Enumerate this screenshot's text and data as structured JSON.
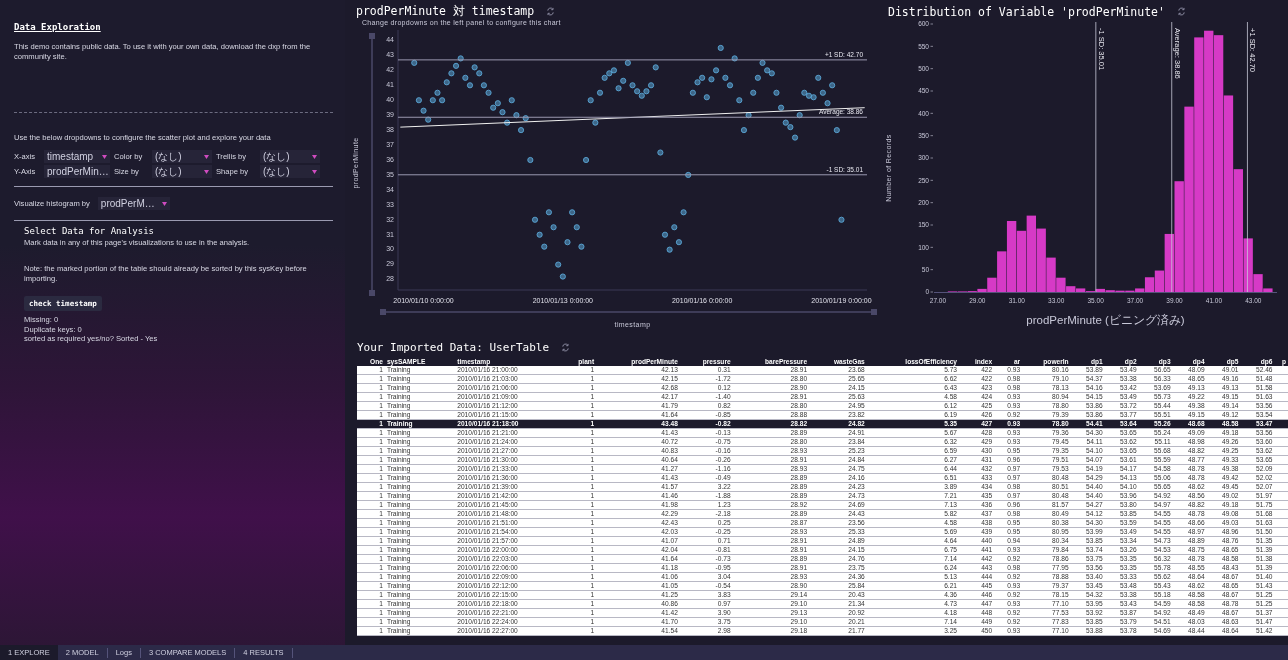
{
  "left_panel": {
    "heading": "Data Exploration",
    "intro": "This demo contains public data. To use it with your own data, download the dxp from the community site.",
    "instructions": "Use the below dropdowns to configure the scatter plot and explore your data",
    "dropdowns": [
      {
        "label": "X-axis",
        "value": "timestamp"
      },
      {
        "label": "Color by",
        "value": "(なし)"
      },
      {
        "label": "Trellis by",
        "value": "(なし)"
      },
      {
        "label": "Y-Axis",
        "value": "prodPerMin…"
      },
      {
        "label": "Size by",
        "value": "(なし)"
      },
      {
        "label": "Shape by",
        "value": "(なし)"
      }
    ],
    "histogram_dropdown": {
      "label": "Visualize histogram by",
      "value": "prodPerM…"
    },
    "select_title": "Select Data for Analysis",
    "select_text": "Mark data in any of this page's visualizations to use in the analysis.",
    "note": "Note: the marked portion of the table should already be sorted by this sysKey before importing.",
    "button": "check timestamp",
    "results": [
      "Missing:  0",
      "Duplicate keys: 0",
      "sorted as required yes/no? Sorted - Yes"
    ]
  },
  "scatter": {
    "subtitle": "Change dropdowns on the left panel to configure this chart",
    "chart_data": {
      "type": "scatter",
      "title": "prodPerMinute 対 timestamp",
      "xlabel": "timestamp",
      "ylabel": "prodPerMinute",
      "categories": [
        null,
        null,
        null,
        null,
        null,
        "2010/01/10 0:00:00",
        null,
        null,
        null,
        null,
        null,
        null,
        null,
        null,
        null,
        null,
        null,
        null,
        null,
        null,
        null,
        null,
        null,
        null,
        null,
        null,
        null,
        null,
        null,
        null,
        null,
        null,
        null,
        null,
        null,
        "2010/01/13 0:00:00",
        null,
        null,
        null,
        null,
        null,
        null,
        null,
        null,
        null,
        null,
        null,
        null,
        null,
        null,
        null,
        null,
        null,
        null,
        null,
        null,
        null,
        null,
        null,
        null,
        null,
        null,
        null,
        null,
        null,
        "2010/01/16 0:00:00",
        null,
        null,
        null,
        null,
        null,
        null,
        null,
        null,
        null,
        null,
        null,
        null,
        null,
        null,
        null,
        null,
        null,
        null,
        null,
        null,
        null,
        null,
        null,
        null,
        null,
        null,
        null,
        null,
        null,
        "2010/01/19 0:00:00",
        null,
        null,
        null,
        null,
        null
      ],
      "series": [
        {
          "color": "#5aa6d6",
          "values": [
            null,
            null,
            null,
            42.5,
            40,
            39.3,
            38.7,
            40,
            40.5,
            40,
            41.2,
            41.8,
            42.3,
            42.8,
            41.5,
            41,
            42.2,
            41.8,
            41,
            40.5,
            39.5,
            39.8,
            39.2,
            38.5,
            40,
            39,
            38,
            38.8,
            36,
            32,
            31,
            30.2,
            32.5,
            31.5,
            29,
            28.2,
            30.5,
            32.5,
            31.5,
            30.2,
            36,
            40,
            38.5,
            40.5,
            41.5,
            41.8,
            42,
            40.8,
            41.3,
            42.5,
            41,
            40.6,
            40.3,
            40.6,
            41,
            42.2,
            36.5,
            31,
            30,
            31.5,
            30.5,
            32.5,
            35,
            40.5,
            41.2,
            41.5,
            40.2,
            41.4,
            42,
            43.5,
            41.5,
            41,
            42.8,
            40,
            38,
            39,
            40.5,
            41.5,
            42.5,
            42,
            41.8,
            40.5,
            39.5,
            38.5,
            38.2,
            37.5,
            39,
            40.5,
            40.3,
            40.2,
            41.5,
            40.5,
            39.8,
            41,
            38,
            32,
            null,
            null,
            null,
            null,
            null
          ]
        },
        {
          "type": "line",
          "color": "#f0f0f0",
          "values": [
            38.2,
            null,
            null,
            null,
            null,
            null,
            null,
            null,
            null,
            null,
            null,
            null,
            null,
            null,
            null,
            null,
            null,
            null,
            null,
            null,
            null,
            null,
            null,
            null,
            null,
            null,
            null,
            null,
            null,
            null,
            null,
            null,
            null,
            null,
            null,
            null,
            null,
            null,
            null,
            null,
            null,
            null,
            null,
            null,
            null,
            null,
            null,
            null,
            null,
            null,
            null,
            null,
            null,
            null,
            null,
            null,
            null,
            null,
            null,
            null,
            null,
            null,
            null,
            null,
            null,
            null,
            null,
            null,
            null,
            null,
            null,
            null,
            null,
            null,
            null,
            null,
            null,
            null,
            null,
            null,
            null,
            null,
            null,
            null,
            null,
            null,
            null,
            null,
            null,
            null,
            null,
            null,
            null,
            null,
            null,
            null,
            null,
            null,
            null,
            null,
            39.5
          ]
        }
      ],
      "ylim": [
        27.3,
        44.7
      ],
      "yticks": [
        28,
        29,
        30,
        31,
        32,
        33,
        34,
        35,
        36,
        37,
        38,
        39,
        40,
        41,
        42,
        43,
        44
      ],
      "ref_lines": [
        {
          "axis": "y",
          "value": 42.7,
          "label": "+1 SD: 42.70"
        },
        {
          "axis": "y",
          "value": 38.86,
          "label": "Average: 38.86"
        },
        {
          "axis": "y",
          "value": 35.01,
          "label": "-1 SD: 35.01"
        }
      ]
    }
  },
  "histogram": {
    "chart_data": {
      "type": "bar",
      "title": "Distribution of Variable 'prodPerMinute'",
      "xlabel": "prodPerMinute (ビニング済み)",
      "ylabel": "Number of Records",
      "x": [
        27.75,
        28.25,
        28.75,
        29.25,
        29.75,
        30.25,
        30.75,
        31.25,
        31.75,
        32.25,
        32.75,
        33.25,
        33.75,
        34.25,
        34.75,
        35.25,
        35.75,
        36.25,
        36.75,
        37.25,
        37.75,
        38.25,
        38.75,
        39.25,
        39.75,
        40.25,
        40.75,
        41.25,
        41.75,
        42.25,
        42.75,
        43.25,
        43.75
      ],
      "values": [
        1,
        1,
        2,
        7,
        32,
        91,
        159,
        137,
        171,
        142,
        77,
        32,
        13,
        8,
        2,
        7,
        4,
        3,
        3,
        8,
        33,
        48,
        130,
        248,
        415,
        570,
        585,
        575,
        440,
        275,
        120,
        40,
        8
      ],
      "color": "#d63ac6",
      "xlim": [
        26.8,
        44.2
      ],
      "ylim": [
        0,
        600
      ],
      "xticks": [
        {
          "value": 27,
          "label": "27.00"
        },
        {
          "value": 29,
          "label": "29.00"
        },
        {
          "value": 31,
          "label": "31.00"
        },
        {
          "value": 33,
          "label": "33.00"
        },
        {
          "value": 35,
          "label": "35.00"
        },
        {
          "value": 37,
          "label": "37.00"
        },
        {
          "value": 39,
          "label": "39.00"
        },
        {
          "value": 41,
          "label": "41.00"
        },
        {
          "value": 43,
          "label": "43.00"
        }
      ],
      "yticks": [
        0,
        50,
        100,
        150,
        200,
        250,
        300,
        350,
        400,
        450,
        500,
        550,
        600
      ],
      "ref_lines": [
        {
          "axis": "x",
          "value": 35.01,
          "label": "-1 SD: 35.01"
        },
        {
          "axis": "x",
          "value": 38.86,
          "label": "Average: 38.86"
        },
        {
          "axis": "x",
          "value": 42.7,
          "label": "+1 SD: 42.70"
        }
      ]
    }
  },
  "table": {
    "title": "Your Imported Data: UserTable",
    "columns": [
      "One",
      "sysSAMPLE",
      "timestamp",
      "plant",
      "prodPerMinute",
      "pressure",
      "barePressure",
      "wasteGas",
      "lossOfEfficiency",
      "index",
      "ar",
      "powerIn",
      "dp1",
      "dp2",
      "dp3",
      "dp4",
      "dp5",
      "dp6",
      "p"
    ],
    "rows": [
      {
        "selected": false,
        "cells": [
          "1",
          "Training",
          "2010/01/16 21:00:00",
          "1",
          "42.13",
          "0.31",
          "28.91",
          "23.68",
          "5.73",
          "422",
          "0.93",
          "80.16",
          "53.89",
          "53.49",
          "56.65",
          "48.09",
          "49.01",
          "52.46"
        ]
      },
      {
        "selected": false,
        "cells": [
          "1",
          "Training",
          "2010/01/16 21:03:00",
          "1",
          "42.15",
          "-1.72",
          "28.80",
          "25.65",
          "6.62",
          "422",
          "0.98",
          "79.10",
          "54.37",
          "53.38",
          "56.33",
          "48.65",
          "49.16",
          "51.48"
        ]
      },
      {
        "selected": false,
        "cells": [
          "1",
          "Training",
          "2010/01/16 21:06:00",
          "1",
          "42.68",
          "0.12",
          "28.90",
          "24.15",
          "6.43",
          "423",
          "0.98",
          "78.13",
          "54.16",
          "53.42",
          "53.69",
          "49.13",
          "49.13",
          "51.58"
        ]
      },
      {
        "selected": false,
        "cells": [
          "1",
          "Training",
          "2010/01/16 21:09:00",
          "1",
          "42.17",
          "-1.40",
          "28.91",
          "25.63",
          "4.58",
          "424",
          "0.93",
          "80.94",
          "54.15",
          "53.49",
          "55.73",
          "49.22",
          "49.15",
          "51.63"
        ]
      },
      {
        "selected": false,
        "cells": [
          "1",
          "Training",
          "2010/01/16 21:12:00",
          "1",
          "41.79",
          "0.82",
          "28.80",
          "24.95",
          "6.12",
          "425",
          "0.93",
          "78.80",
          "53.86",
          "53.72",
          "55.44",
          "49.38",
          "49.14",
          "53.56"
        ]
      },
      {
        "selected": false,
        "cells": [
          "1",
          "Training",
          "2010/01/16 21:15:00",
          "1",
          "41.64",
          "-0.85",
          "28.88",
          "23.82",
          "6.19",
          "426",
          "0.92",
          "79.39",
          "53.86",
          "53.77",
          "55.51",
          "49.15",
          "49.12",
          "53.54"
        ]
      },
      {
        "selected": true,
        "cells": [
          "1",
          "Training",
          "2010/01/16 21:18:00",
          "1",
          "43.48",
          "-0.82",
          "28.82",
          "24.82",
          "5.35",
          "427",
          "0.93",
          "78.80",
          "54.41",
          "53.64",
          "55.26",
          "48.68",
          "48.58",
          "53.47"
        ]
      },
      {
        "selected": false,
        "cells": [
          "1",
          "Training",
          "2010/01/16 21:21:00",
          "1",
          "41.43",
          "-0.13",
          "28.89",
          "24.91",
          "5.67",
          "428",
          "0.93",
          "79.36",
          "54.30",
          "53.65",
          "55.24",
          "49.09",
          "49.18",
          "53.56"
        ]
      },
      {
        "selected": false,
        "cells": [
          "1",
          "Training",
          "2010/01/16 21:24:00",
          "1",
          "40.72",
          "-0.75",
          "28.80",
          "23.84",
          "6.32",
          "429",
          "0.93",
          "79.45",
          "54.11",
          "53.62",
          "55.11",
          "48.98",
          "49.26",
          "53.60"
        ]
      },
      {
        "selected": false,
        "cells": [
          "1",
          "Training",
          "2010/01/16 21:27:00",
          "1",
          "40.83",
          "-0.16",
          "28.93",
          "25.23",
          "6.59",
          "430",
          "0.95",
          "79.35",
          "54.10",
          "53.65",
          "55.68",
          "48.82",
          "49.25",
          "53.62"
        ]
      },
      {
        "selected": false,
        "cells": [
          "1",
          "Training",
          "2010/01/16 21:30:00",
          "1",
          "40.64",
          "-0.26",
          "28.91",
          "24.84",
          "6.27",
          "431",
          "0.96",
          "79.51",
          "54.07",
          "53.61",
          "55.59",
          "48.77",
          "49.33",
          "53.65"
        ]
      },
      {
        "selected": false,
        "cells": [
          "1",
          "Training",
          "2010/01/16 21:33:00",
          "1",
          "41.27",
          "-1.16",
          "28.93",
          "24.75",
          "6.44",
          "432",
          "0.97",
          "79.53",
          "54.19",
          "54.17",
          "54.58",
          "48.78",
          "49.38",
          "52.09"
        ]
      },
      {
        "selected": false,
        "cells": [
          "1",
          "Training",
          "2010/01/16 21:36:00",
          "1",
          "41.43",
          "-0.49",
          "28.89",
          "24.16",
          "6.51",
          "433",
          "0.97",
          "80.48",
          "54.29",
          "54.13",
          "55.06",
          "48.78",
          "49.42",
          "52.02"
        ]
      },
      {
        "selected": false,
        "cells": [
          "1",
          "Training",
          "2010/01/16 21:39:00",
          "1",
          "41.57",
          "3.22",
          "28.89",
          "24.23",
          "3.89",
          "434",
          "0.98",
          "80.51",
          "54.40",
          "54.10",
          "55.65",
          "48.62",
          "49.45",
          "52.07"
        ]
      },
      {
        "selected": false,
        "cells": [
          "1",
          "Training",
          "2010/01/16 21:42:00",
          "1",
          "41.46",
          "-1.88",
          "28.89",
          "24.73",
          "7.21",
          "435",
          "0.97",
          "80.48",
          "54.40",
          "53.96",
          "54.92",
          "48.56",
          "49.02",
          "51.97"
        ]
      },
      {
        "selected": false,
        "cells": [
          "1",
          "Training",
          "2010/01/16 21:45:00",
          "1",
          "41.98",
          "1.23",
          "28.92",
          "24.69",
          "7.13",
          "436",
          "0.96",
          "81.57",
          "54.27",
          "53.80",
          "54.97",
          "48.82",
          "49.18",
          "51.75"
        ]
      },
      {
        "selected": false,
        "cells": [
          "1",
          "Training",
          "2010/01/16 21:48:00",
          "1",
          "42.29",
          "-2.18",
          "28.89",
          "24.43",
          "5.82",
          "437",
          "0.98",
          "80.49",
          "54.12",
          "53.85",
          "54.55",
          "48.78",
          "49.08",
          "51.68"
        ]
      },
      {
        "selected": false,
        "cells": [
          "1",
          "Training",
          "2010/01/16 21:51:00",
          "1",
          "42.43",
          "0.25",
          "28.87",
          "23.56",
          "4.58",
          "438",
          "0.95",
          "80.38",
          "54.30",
          "53.59",
          "54.55",
          "48.66",
          "49.03",
          "51.63"
        ]
      },
      {
        "selected": false,
        "cells": [
          "1",
          "Training",
          "2010/01/16 21:54:00",
          "1",
          "42.03",
          "-0.25",
          "28.93",
          "25.33",
          "5.69",
          "439",
          "0.95",
          "80.95",
          "53.99",
          "53.49",
          "54.55",
          "48.97",
          "48.96",
          "51.50"
        ]
      },
      {
        "selected": false,
        "cells": [
          "1",
          "Training",
          "2010/01/16 21:57:00",
          "1",
          "41.07",
          "0.71",
          "28.91",
          "24.89",
          "4.64",
          "440",
          "0.94",
          "80.34",
          "53.85",
          "53.34",
          "54.73",
          "48.89",
          "48.76",
          "51.35"
        ]
      },
      {
        "selected": false,
        "cells": [
          "1",
          "Training",
          "2010/01/16 22:00:00",
          "1",
          "42.04",
          "-0.81",
          "28.91",
          "24.15",
          "6.75",
          "441",
          "0.93",
          "79.84",
          "53.74",
          "53.26",
          "54.53",
          "48.75",
          "48.65",
          "51.39"
        ]
      },
      {
        "selected": false,
        "cells": [
          "1",
          "Training",
          "2010/01/16 22:03:00",
          "1",
          "41.64",
          "-0.73",
          "28.89",
          "24.76",
          "7.14",
          "442",
          "0.92",
          "78.86",
          "53.75",
          "53.35",
          "56.32",
          "48.78",
          "48.58",
          "51.38"
        ]
      },
      {
        "selected": false,
        "cells": [
          "1",
          "Training",
          "2010/01/16 22:06:00",
          "1",
          "41.18",
          "-0.95",
          "28.91",
          "23.75",
          "6.24",
          "443",
          "0.98",
          "77.95",
          "53.56",
          "53.35",
          "55.78",
          "48.55",
          "48.43",
          "51.39"
        ]
      },
      {
        "selected": false,
        "cells": [
          "1",
          "Training",
          "2010/01/16 22:09:00",
          "1",
          "41.06",
          "3.04",
          "28.93",
          "24.36",
          "5.13",
          "444",
          "0.92",
          "78.88",
          "53.40",
          "53.33",
          "55.62",
          "48.64",
          "48.67",
          "51.40"
        ]
      },
      {
        "selected": false,
        "cells": [
          "1",
          "Training",
          "2010/01/16 22:12:00",
          "1",
          "41.05",
          "-0.54",
          "28.90",
          "25.84",
          "6.21",
          "445",
          "0.93",
          "79.37",
          "53.45",
          "53.48",
          "55.43",
          "48.62",
          "48.65",
          "51.43"
        ]
      },
      {
        "selected": false,
        "cells": [
          "1",
          "Training",
          "2010/01/16 22:15:00",
          "1",
          "41.25",
          "3.83",
          "29.14",
          "20.43",
          "4.36",
          "446",
          "0.92",
          "78.15",
          "54.32",
          "53.38",
          "55.18",
          "48.58",
          "48.67",
          "51.25"
        ]
      },
      {
        "selected": false,
        "cells": [
          "1",
          "Training",
          "2010/01/16 22:18:00",
          "1",
          "40.86",
          "0.97",
          "29.10",
          "21.34",
          "4.73",
          "447",
          "0.93",
          "77.10",
          "53.95",
          "53.43",
          "54.59",
          "48.58",
          "48.78",
          "51.25"
        ]
      },
      {
        "selected": false,
        "cells": [
          "1",
          "Training",
          "2010/01/16 22:21:00",
          "1",
          "41.42",
          "3.90",
          "29.13",
          "20.92",
          "4.18",
          "448",
          "0.92",
          "77.53",
          "53.92",
          "53.87",
          "54.92",
          "48.49",
          "48.67",
          "51.37"
        ]
      },
      {
        "selected": false,
        "cells": [
          "1",
          "Training",
          "2010/01/16 22:24:00",
          "1",
          "41.70",
          "3.75",
          "29.10",
          "20.21",
          "7.14",
          "449",
          "0.92",
          "77.83",
          "53.85",
          "53.79",
          "54.51",
          "48.03",
          "48.63",
          "51.47"
        ]
      },
      {
        "selected": false,
        "cells": [
          "1",
          "Training",
          "2010/01/16 22:27:00",
          "1",
          "41.54",
          "2.98",
          "29.18",
          "21.77",
          "3.25",
          "450",
          "0.93",
          "77.10",
          "53.88",
          "53.78",
          "54.69",
          "48.44",
          "48.64",
          "51.42"
        ]
      }
    ]
  },
  "bottom_tabs": [
    {
      "label": "1 EXPLORE",
      "selected": true
    },
    {
      "label": "2 MODEL",
      "selected": false
    },
    {
      "label": "Logs",
      "selected": false
    },
    {
      "label": "3 COMPARE MODELS",
      "selected": false
    },
    {
      "label": "4 RESULTS",
      "selected": false
    }
  ]
}
